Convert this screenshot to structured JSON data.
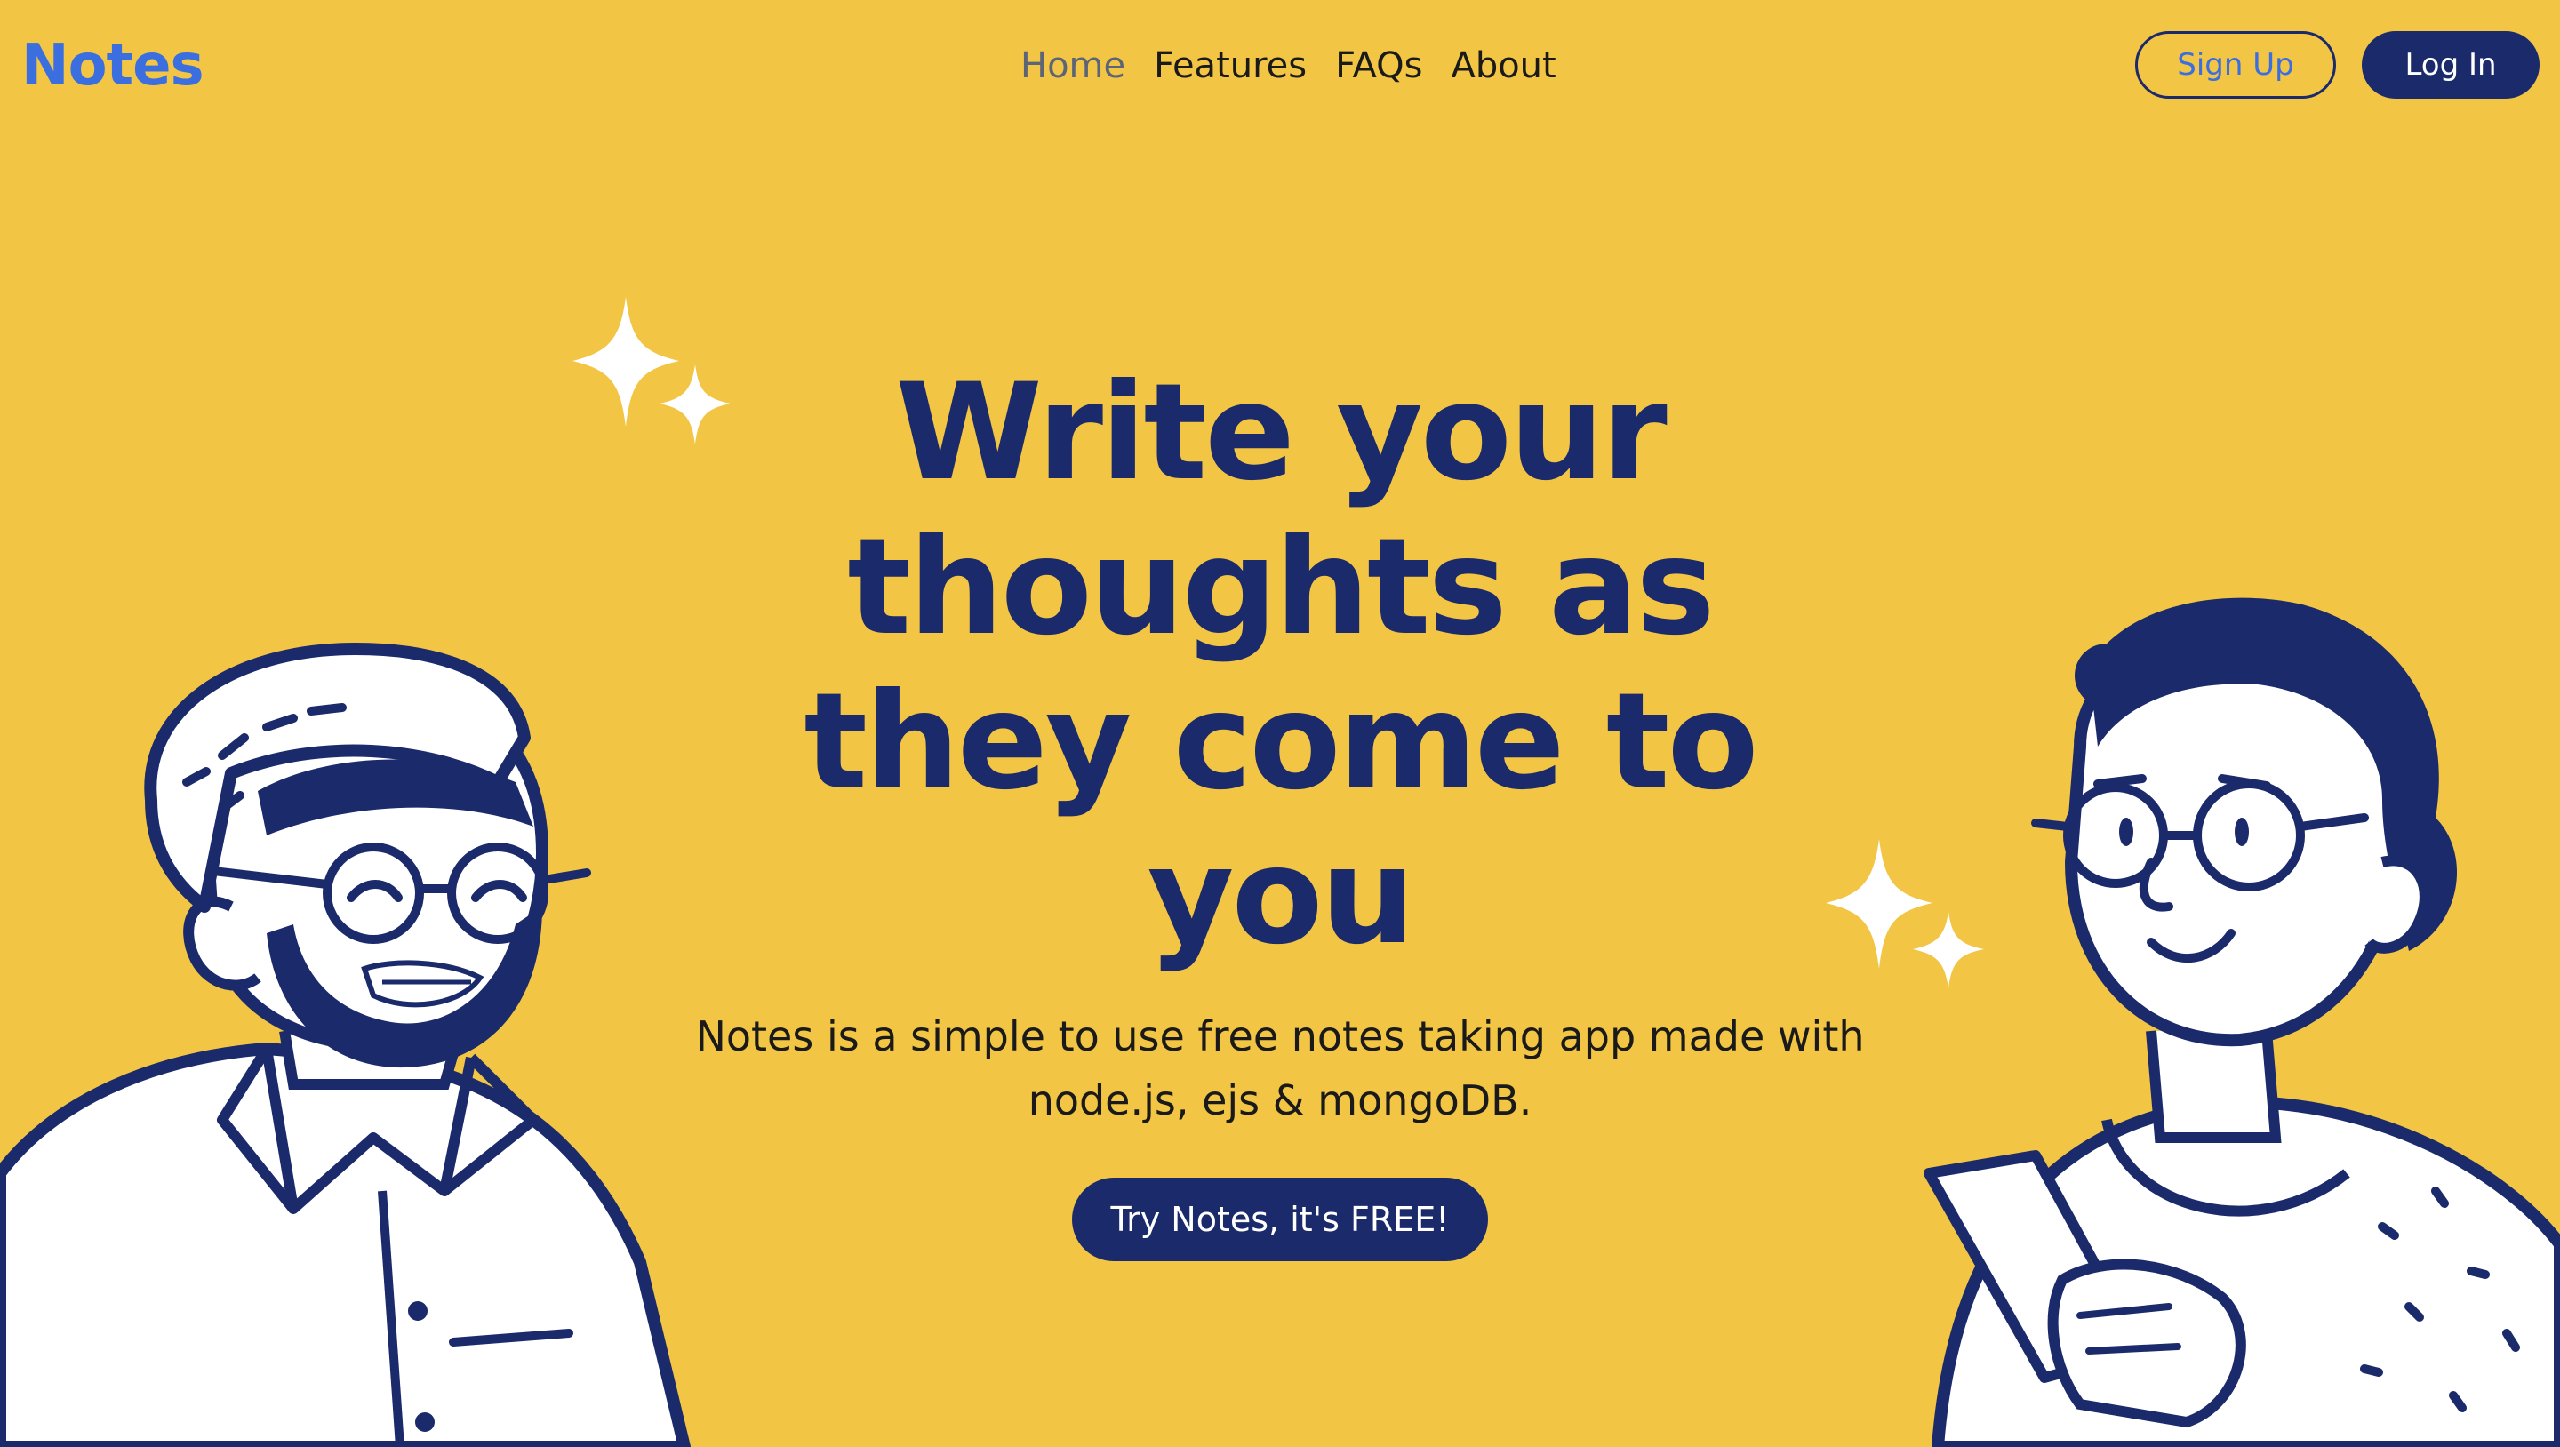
{
  "brand": {
    "logo": "Notes",
    "primary": "#3B6FE0",
    "navy": "#1B2A6B",
    "background": "#F2C544"
  },
  "nav": {
    "items": [
      "Home",
      "Features",
      "FAQs",
      "About"
    ],
    "active": "Home"
  },
  "auth": {
    "signup_label": "Sign Up",
    "login_label": "Log In"
  },
  "hero": {
    "title": "Write your thoughts as they come to you",
    "subtitle": "Notes is a simple to use free notes taking app made with node.js, ejs & mongoDB.",
    "cta_label": "Try Notes, it's FREE!"
  },
  "icons": {
    "sparkle": "sparkle-icon",
    "man": "man-illustration",
    "woman": "woman-illustration"
  }
}
